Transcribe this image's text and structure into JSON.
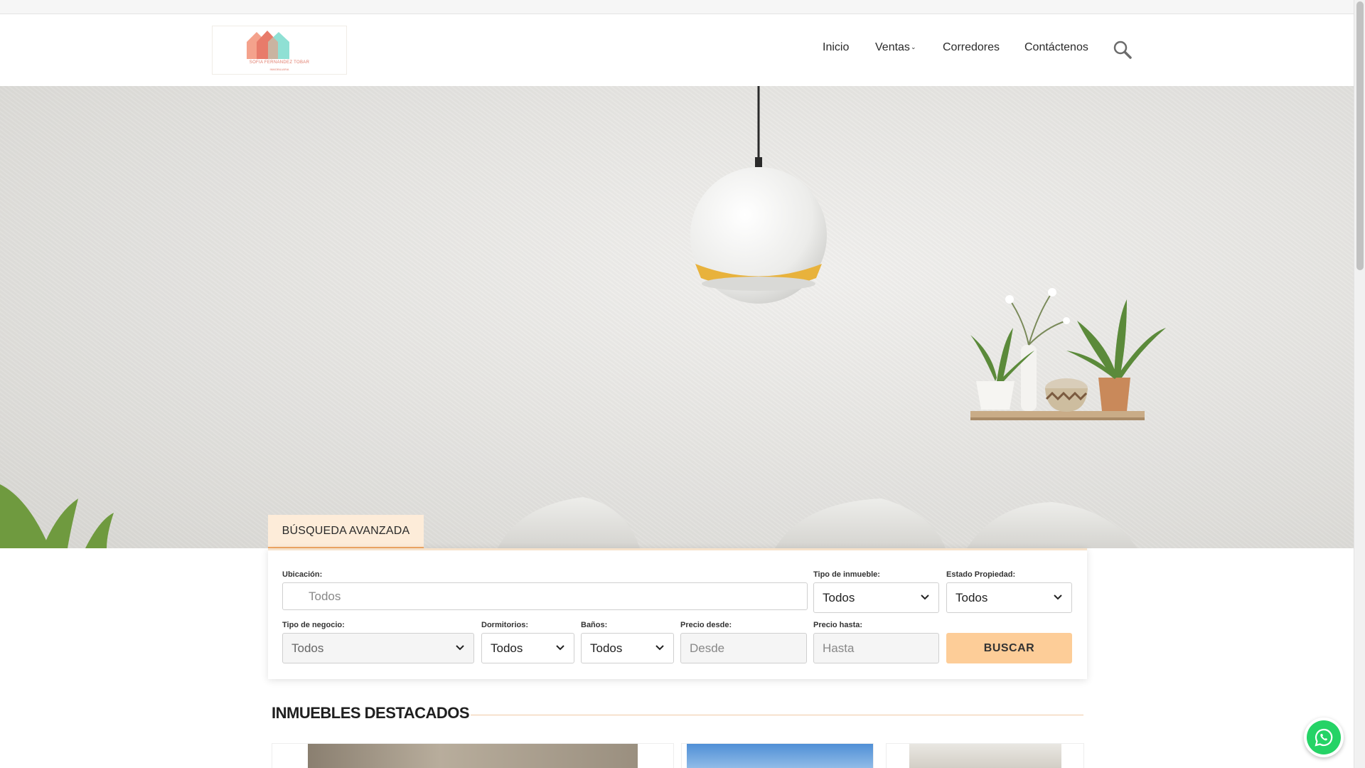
{
  "nav": {
    "items": [
      {
        "label": "Inicio"
      },
      {
        "label": "Ventas"
      },
      {
        "label": "Corredores"
      },
      {
        "label": "Contáctenos"
      }
    ]
  },
  "logo": {
    "name": "SOFIA FERNANDEZ TOBAR",
    "subtitle": "INMOBILIARIA"
  },
  "search": {
    "tab_label": "BÚSQUEDA AVANZADA",
    "fields": {
      "ubicacion": {
        "label": "Ubicación:",
        "placeholder": "Todos"
      },
      "tipo_inmueble": {
        "label": "Tipo de inmueble:",
        "value": "Todos"
      },
      "estado": {
        "label": "Estado Propiedad:",
        "value": "Todos"
      },
      "tipo_negocio": {
        "label": "Tipo de negocio:",
        "value": "Todos"
      },
      "dormitorios": {
        "label": "Dormitorios:",
        "value": "Todos"
      },
      "banos": {
        "label": "Baños:",
        "value": "Todos"
      },
      "precio_desde": {
        "label": "Precio desde:",
        "placeholder": "Desde"
      },
      "precio_hasta": {
        "label": "Precio hasta:",
        "placeholder": "Hasta"
      }
    },
    "button_label": "BUSCAR"
  },
  "featured": {
    "title": "INMUEBLES DESTACADOS"
  },
  "icons": {
    "search": "search-icon",
    "whatsapp": "whatsapp-icon",
    "chevron": "chevron-down-icon"
  },
  "colors": {
    "accent": "#f2a865",
    "button": "#fdcd98",
    "tab_bg": "#fdecd9",
    "whatsapp": "#25d366"
  }
}
